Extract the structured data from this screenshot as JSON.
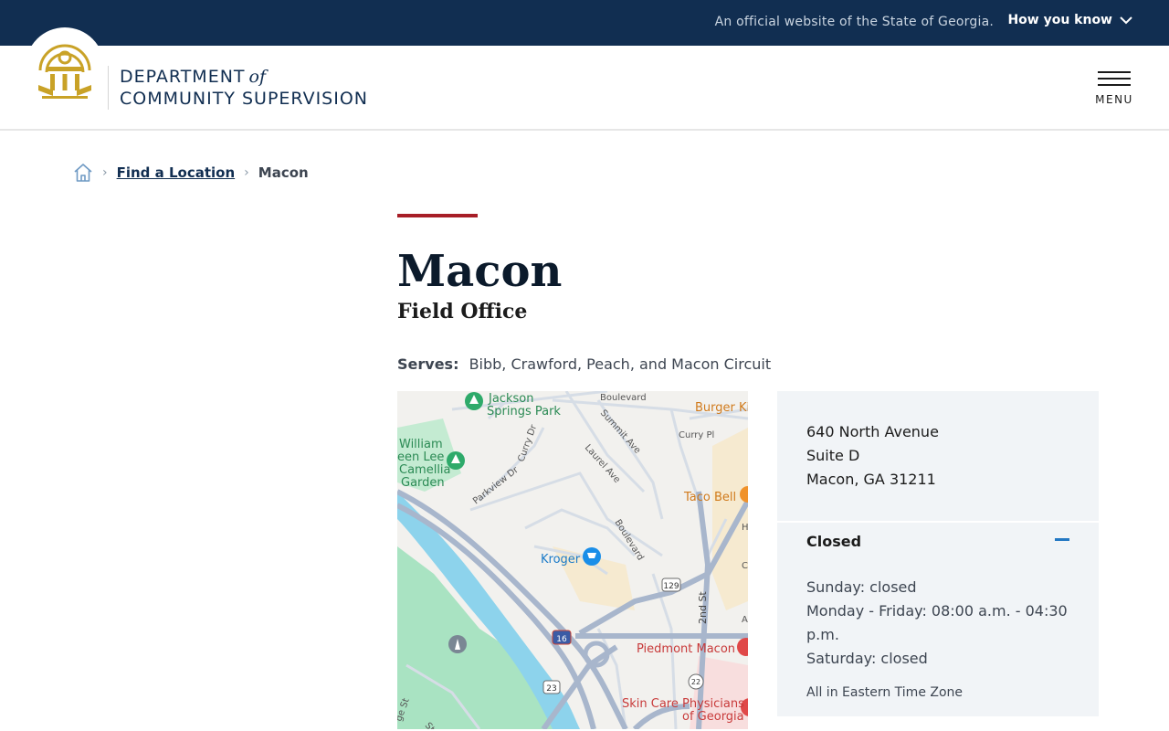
{
  "banner": {
    "official_text": "An official website of the State of Georgia.",
    "how_you_know": "How you know"
  },
  "header": {
    "agency_line1": "DEPARTMENT",
    "agency_of": "of",
    "agency_line2": "COMMUNITY SUPERVISION",
    "menu_label": "MENU"
  },
  "breadcrumb": {
    "items": [
      "Find a Location",
      "Macon"
    ]
  },
  "page": {
    "title": "Macon",
    "subtitle": "Field Office",
    "serves_label": "Serves:",
    "serves_value": "Bibb, Crawford, Peach, and Macon Circuit"
  },
  "map": {
    "labels": {
      "park": "Jackson Springs Park",
      "garden": "William Green Lee Camellia Garden",
      "boulevard_top": "Boulevard",
      "summit": "Summit Ave",
      "curry_pl": "Curry Pl",
      "curry_dr": "Curry Dr",
      "laurel": "Laurel Ave",
      "parkview": "Parkview Dr",
      "boulevard": "Boulevard",
      "burger": "Burger Ki",
      "taco": "Taco Bell",
      "kroger": "Kroger",
      "second_st": "2nd St",
      "piedmont": "Piedmont Macon",
      "skincare_1": "Skin Care Physicians",
      "skincare_2": "of Georgia",
      "route_129": "129",
      "route_16": "16",
      "route_23": "23",
      "route_22": "22",
      "edge_st_1": "ge St",
      "edge_st_2": "St",
      "edge_h": "H",
      "edge_c": "C",
      "edge_a": "A"
    }
  },
  "location": {
    "address_line1": "640 North Avenue",
    "address_line2": "Suite D",
    "address_line3": "Macon, GA 31211",
    "status": "Closed",
    "hours": [
      "Sunday: closed",
      "Monday - Friday: 08:00 a.m. - 04:30 p.m.",
      "Saturday: closed"
    ],
    "timezone_note": "All in Eastern Time Zone"
  },
  "colors": {
    "banner_bg": "#112e51",
    "accent_red": "#a71e27",
    "seal_gold": "#c9a227",
    "card_bg": "#f1f4f7",
    "link_blue": "#2378c3"
  }
}
